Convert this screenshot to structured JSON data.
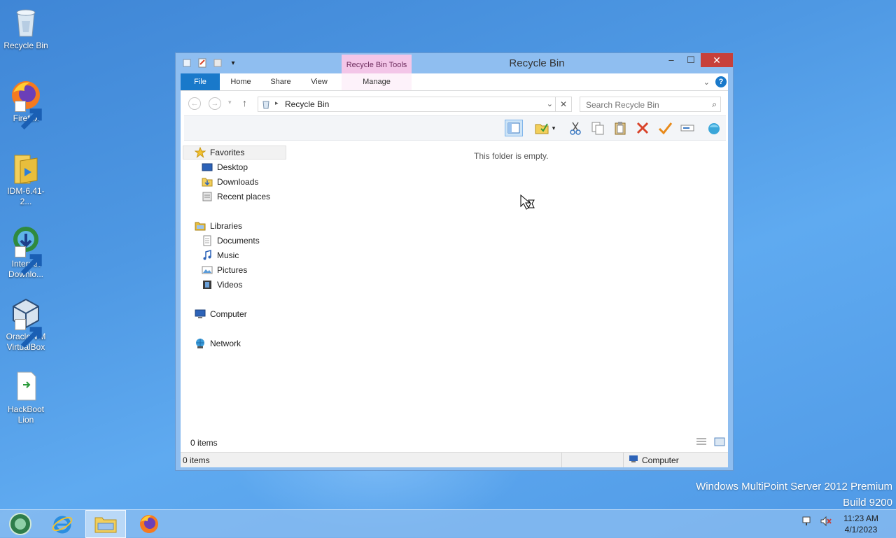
{
  "desktop": {
    "icons": [
      {
        "label": "Recycle Bin",
        "icon": "recycle-bin-icon"
      },
      {
        "label": "Firefox",
        "icon": "firefox-icon"
      },
      {
        "label": "IDM-6.41-2...",
        "icon": "folder-icon"
      },
      {
        "label": "Internet Downlo...",
        "icon": "internet-download-manager-icon"
      },
      {
        "label": "Oracle VM VirtualBox",
        "icon": "virtualbox-icon"
      },
      {
        "label": "HackBoot Lion",
        "icon": "document-icon"
      }
    ],
    "watermark": {
      "line1": "Windows MultiPoint Server 2012 Premium",
      "line2": "Build 9200"
    }
  },
  "window": {
    "title": "Recycle Bin",
    "context_tab_group": "Recycle Bin Tools",
    "ribbon_tabs": [
      "File",
      "Home",
      "Share",
      "View",
      "Manage"
    ],
    "controls": {
      "minimize": "–",
      "maximize": "☐",
      "close": "✕"
    },
    "address": {
      "crumb": "Recycle Bin"
    },
    "search": {
      "placeholder": "Search Recycle Bin"
    },
    "nav": {
      "favorites": {
        "label": "Favorites",
        "items": [
          "Desktop",
          "Downloads",
          "Recent places"
        ]
      },
      "libraries": {
        "label": "Libraries",
        "items": [
          "Documents",
          "Music",
          "Pictures",
          "Videos"
        ]
      },
      "computer": "Computer",
      "network": "Network"
    },
    "empty_message": "This folder is empty.",
    "content_count": "0 items",
    "status": {
      "left": "0 items",
      "location": "Computer"
    }
  },
  "taskbar": {
    "items": [
      "start-orb-icon",
      "internet-explorer-icon",
      "file-explorer-icon",
      "firefox-icon"
    ],
    "clock": {
      "time": "11:23 AM",
      "date": "4/1/2023"
    }
  },
  "colors": {
    "accent": "#1979ca",
    "close": "#c7403a",
    "context_tab": "#f3c6e8"
  }
}
